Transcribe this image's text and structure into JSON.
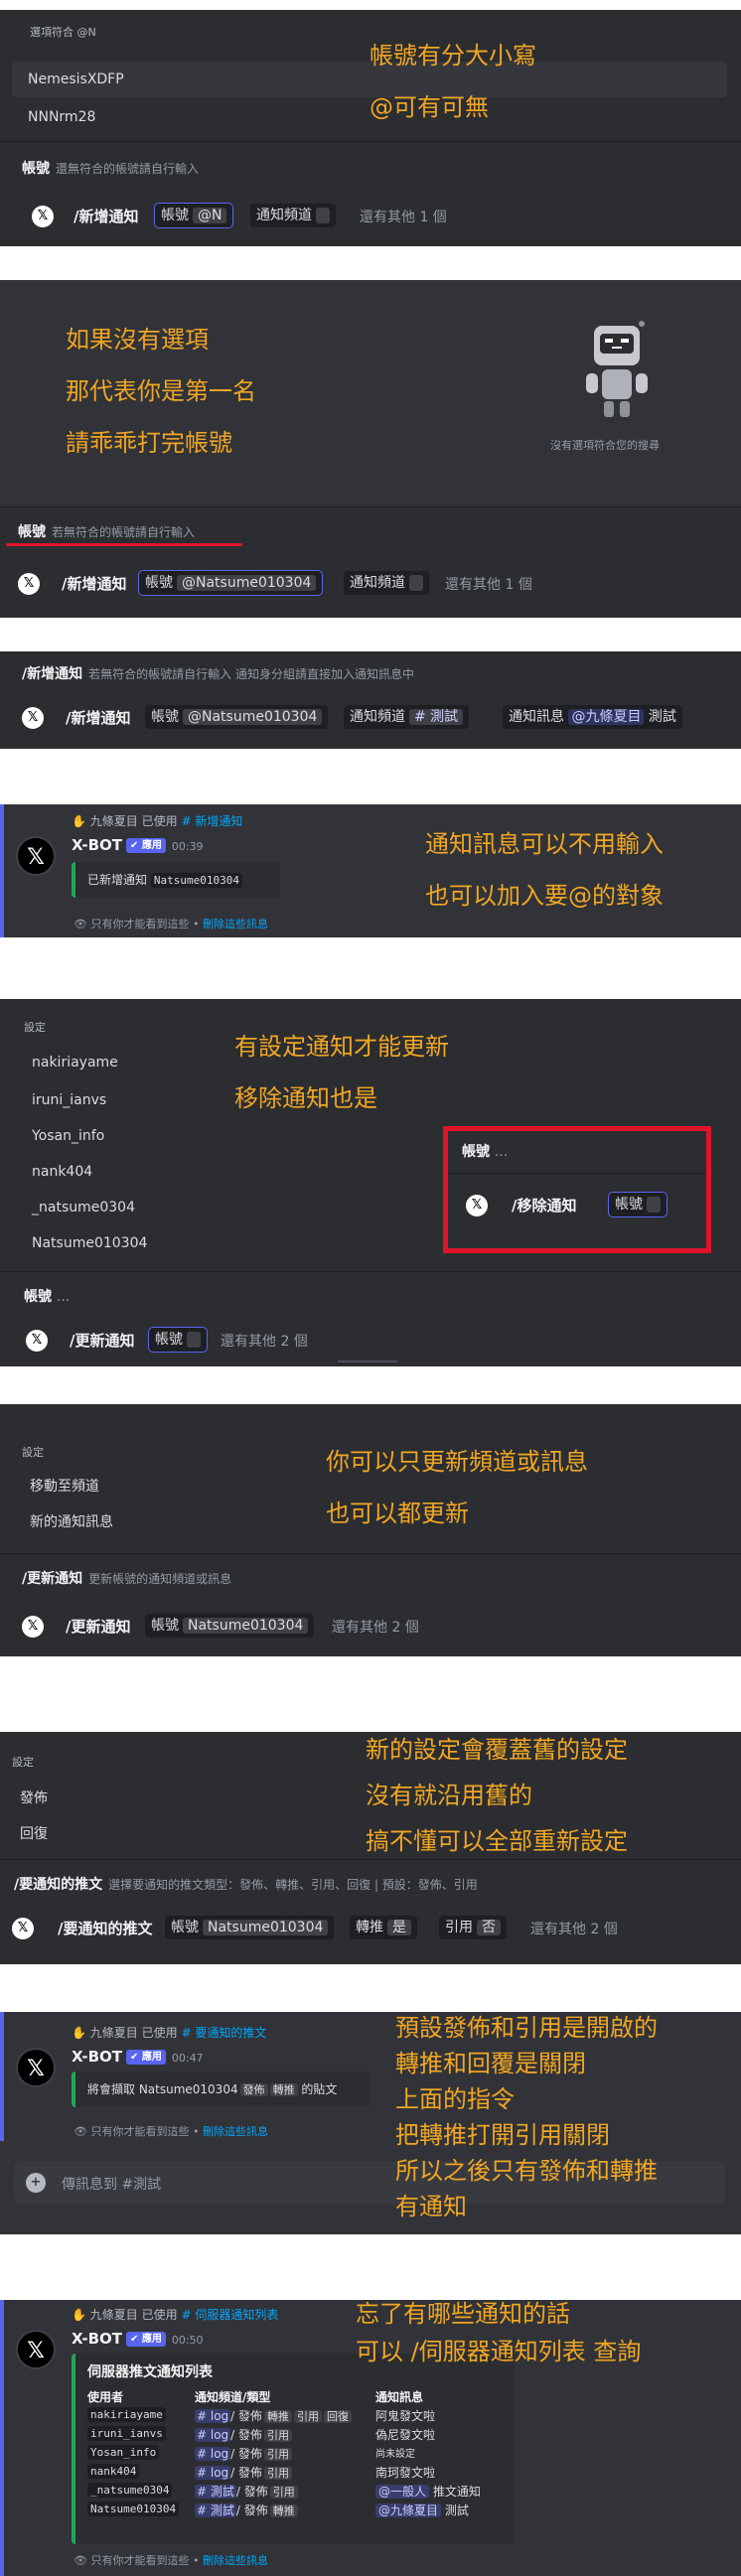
{
  "p1": {
    "head": "選項符合 @N",
    "options": [
      "NemesisXDFP",
      "NNNrm28"
    ],
    "annotations": [
      "帳號有分大小寫",
      "@可有可無"
    ],
    "field_title": "帳號",
    "field_hint": "還無符合的帳號請自行輸入",
    "cmd": "/新增通知",
    "chip1_label": "帳號",
    "chip1_value": "@N",
    "chip2_label": "通知頻道",
    "more": "還有其他 1 個"
  },
  "p2": {
    "annotations": [
      "如果沒有選項",
      "那代表你是第一名",
      "請乖乖打完帳號"
    ],
    "empty_text": "沒有選項符合您的搜尋",
    "field_title": "帳號",
    "field_hint": "若無符合的帳號請自行輸入",
    "cmd": "/新增通知",
    "chip1_label": "帳號",
    "chip1_value": "@Natsume010304",
    "chip2_label": "通知頻道",
    "more": "還有其他 1 個"
  },
  "p3": {
    "title": "/新增通知",
    "hint": "若無符合的帳號請自行輸入 通知身分組請直接加入通知訊息中",
    "cmd": "/新增通知",
    "chip1_label": "帳號",
    "chip1_value": "@Natsume010304",
    "chip2_label": "通知頻道",
    "chip2_value": "# 測試",
    "chip3_label": "通知訊息",
    "chip3_mention": "@九條夏目",
    "chip3_text": "測試"
  },
  "p4": {
    "reply_user": "九條夏目",
    "reply_used": "已使用",
    "reply_cmd": "# 新增通知",
    "bot": "X-BOT",
    "app": "✔ 應用",
    "time": "00:39",
    "embed_text": "已新增通知",
    "embed_mono": "Natsume010304",
    "ephemeral": "只有你才能看到這些 •",
    "dismiss": "刪除這些訊息",
    "annotations": [
      "通知訊息可以不用輸入",
      "也可以加入要@的對象"
    ]
  },
  "p5": {
    "head": "設定",
    "options": [
      "nakiriayame",
      "iruni_ianvs",
      "Yosan_info",
      "nank404",
      "_natsume0304",
      "Natsume010304"
    ],
    "annotations": [
      "有設定通知才能更新",
      "移除通知也是"
    ],
    "popup_title": "帳號",
    "popup_dots": "...",
    "popup_cmd": "/移除通知",
    "popup_chip": "帳號",
    "field_title": "帳號",
    "field_dots": "...",
    "cmd": "/更新通知",
    "chip1_label": "帳號",
    "more": "還有其他 2 個"
  },
  "p6": {
    "head": "設定",
    "options": [
      "移動至頻道",
      "新的通知訊息"
    ],
    "annotations": [
      "你可以只更新頻道或訊息",
      "也可以都更新"
    ],
    "title": "/更新通知",
    "hint": "更新帳號的通知頻道或訊息",
    "cmd": "/更新通知",
    "chip1_label": "帳號",
    "chip1_value": "Natsume010304",
    "more": "還有其他 2 個"
  },
  "p7": {
    "head": "設定",
    "options": [
      "發佈",
      "回復"
    ],
    "annotations": [
      "新的設定會覆蓋舊的設定",
      "沒有就沿用舊的",
      "搞不懂可以全部重新設定"
    ],
    "title": "/要通知的推文",
    "hint": "選擇要通知的推文類型：發佈、轉推、引用、回復 | 預設：發佈、引用",
    "cmd": "/要通知的推文",
    "chip1_label": "帳號",
    "chip1_value": "Natsume010304",
    "chip2_label": "轉推",
    "chip2_value": "是",
    "chip3_label": "引用",
    "chip3_value": "否",
    "more": "還有其他 2 個"
  },
  "p8": {
    "reply_user": "九條夏目",
    "reply_used": "已使用",
    "reply_cmd": "# 要通知的推文",
    "bot": "X-BOT",
    "app": "✔ 應用",
    "time": "00:47",
    "embed_pre": "將會擷取 Natsume010304",
    "embed_tag1": "發佈",
    "embed_tag2": "轉推",
    "embed_post": "的貼文",
    "ephemeral": "只有你才能看到這些 •",
    "dismiss": "刪除這些訊息",
    "input_placeholder": "傳訊息到 #測試",
    "annotations": [
      "預設發佈和引用是開啟的",
      "轉推和回覆是關閉",
      "上面的指令",
      "把轉推打開引用關閉",
      "所以之後只有發佈和轉推",
      "有通知"
    ]
  },
  "p9": {
    "reply_user": "九條夏目",
    "reply_used": "已使用",
    "reply_cmd": "# 伺服器通知列表",
    "bot": "X-BOT",
    "app": "✔ 應用",
    "time": "00:50",
    "embed_title": "伺服器推文通知列表",
    "col1": "使用者",
    "col2": "通知頻道/類型",
    "col3": "通知訊息",
    "rows": [
      {
        "user": "nakiriayame",
        "ch": "# log",
        "types": [
          "發佈",
          "轉推",
          "引用",
          "回復"
        ],
        "msg": "阿鬼發文啦"
      },
      {
        "user": "iruni_ianvs",
        "ch": "# log",
        "types": [
          "發佈",
          "引用"
        ],
        "msg": "偽尼發文啦"
      },
      {
        "user": "Yosan_info",
        "ch": "# log",
        "types": [
          "發佈",
          "引用"
        ],
        "msg": "尚未設定"
      },
      {
        "user": "nank404",
        "ch": "# log",
        "types": [
          "發佈",
          "引用"
        ],
        "msg": "南珂發文啦"
      },
      {
        "user": "_natsume0304",
        "ch": "# 測試",
        "types": [
          "發佈",
          "引用"
        ],
        "msg_mention": "@一般人",
        "msg": "推文通知"
      },
      {
        "user": "Natsume010304",
        "ch": "# 測試",
        "types": [
          "發佈",
          "轉推"
        ],
        "msg_mention": "@九條夏目",
        "msg": "測試"
      }
    ],
    "ephemeral": "只有你才能看到這些 •",
    "dismiss": "刪除這些訊息",
    "annotations": [
      "忘了有哪些通知的話",
      "可以 /伺服器通知列表  查詢"
    ]
  },
  "colors": {
    "accent": "#5865f2",
    "annotation": "#f0a623",
    "highlight_box": "#e0142b",
    "embed_bar": "#23a55a"
  }
}
